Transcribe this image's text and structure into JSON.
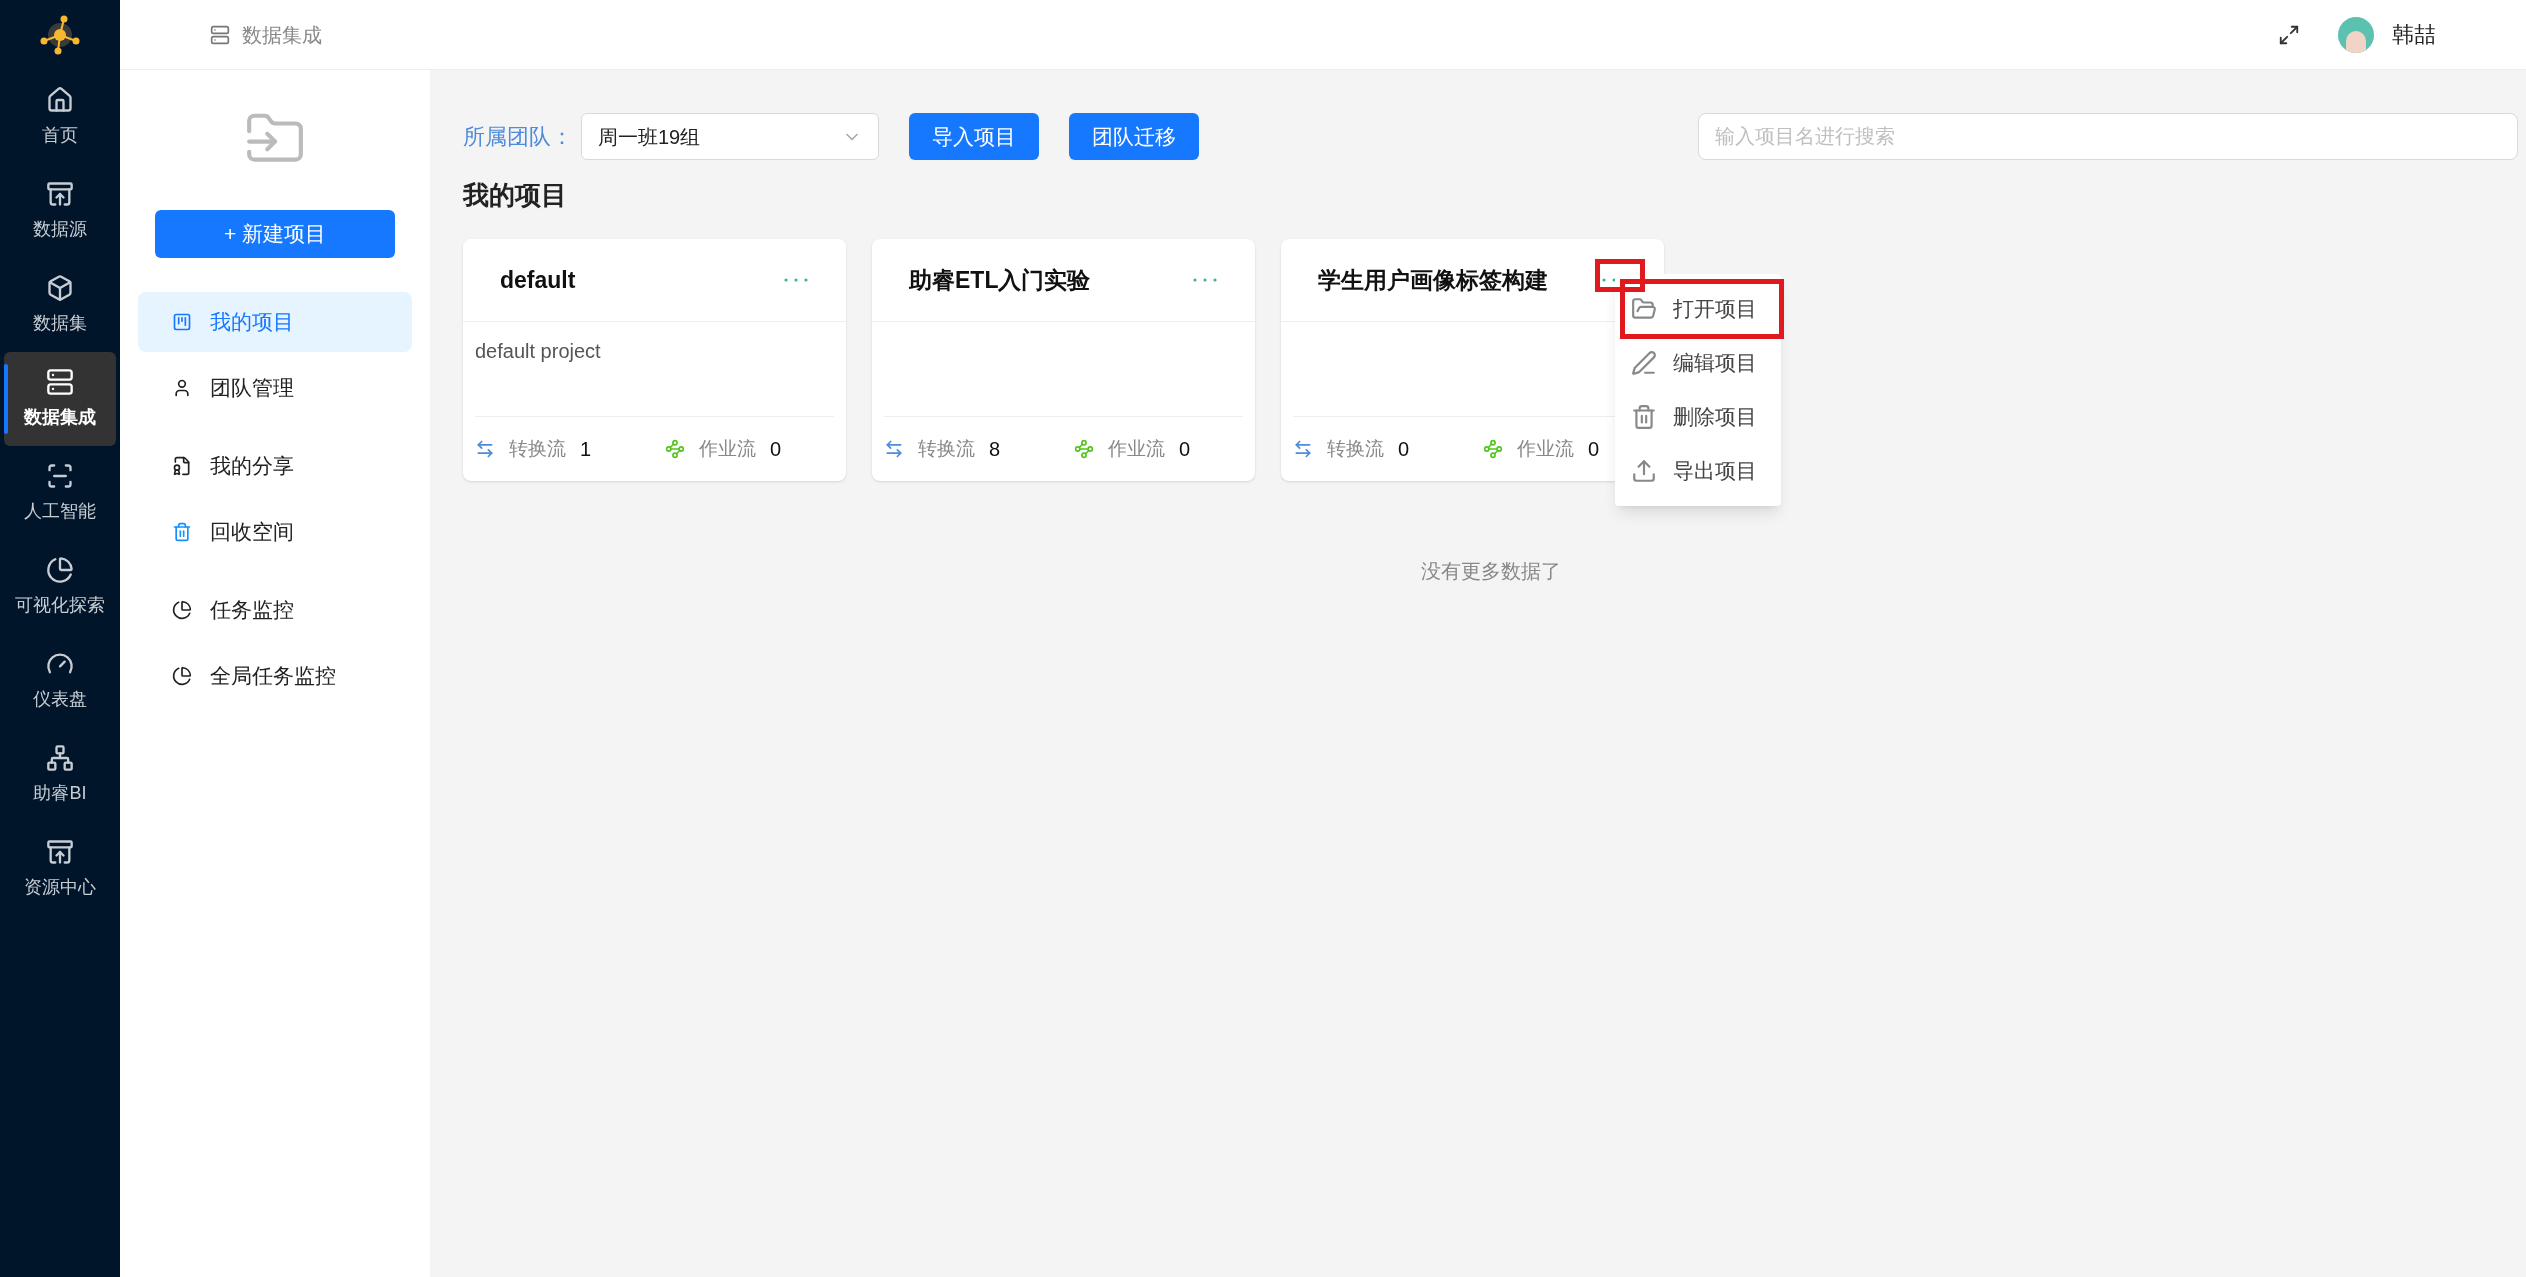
{
  "nav": [
    {
      "label": "首页",
      "kind": "home",
      "selected": false
    },
    {
      "label": "数据源",
      "kind": "cabinet",
      "selected": false
    },
    {
      "label": "数据集",
      "kind": "cube",
      "selected": false
    },
    {
      "label": "数据集成",
      "kind": "server",
      "selected": true
    },
    {
      "label": "人工智能",
      "kind": "scan",
      "selected": false
    },
    {
      "label": "可视化探索",
      "kind": "pie",
      "selected": false
    },
    {
      "label": "仪表盘",
      "kind": "gauge",
      "selected": false
    },
    {
      "label": "助睿BI",
      "kind": "network",
      "selected": false
    },
    {
      "label": "资源中心",
      "kind": "cabinet",
      "selected": false
    }
  ],
  "header": {
    "section_title": "数据集成",
    "user_name": "韩喆"
  },
  "sidebar": {
    "new_button": "+ 新建项目",
    "groups": [
      {
        "items": [
          {
            "label": "我的项目",
            "kind": "board",
            "selected": true
          },
          {
            "label": "团队管理",
            "kind": "user",
            "selected": false
          }
        ]
      },
      {
        "items": [
          {
            "label": "我的分享",
            "kind": "share",
            "selected": false
          },
          {
            "label": "回收空间",
            "kind": "trash",
            "selected": false
          }
        ]
      },
      {
        "items": [
          {
            "label": "任务监控",
            "kind": "pie",
            "selected": false
          },
          {
            "label": "全局任务监控",
            "kind": "pie",
            "selected": false
          }
        ]
      }
    ]
  },
  "toolbar": {
    "team_label": "所属团队：",
    "team_value": "周一班19组",
    "buttons": [
      "导入项目",
      "团队迁移"
    ],
    "search": {
      "placeholder": "输入项目名进行搜索"
    }
  },
  "section_title": "我的项目",
  "projects": [
    {
      "name": "default",
      "description": "default project",
      "transform_label": "转换流",
      "transform_count": "1",
      "job_label": "作业流",
      "job_count": "0",
      "menu_open": false,
      "trigger_highlighted": false
    },
    {
      "name": "助睿ETL入门实验",
      "transform_label": "转换流",
      "transform_count": "8",
      "job_label": "作业流",
      "job_count": "0",
      "menu_open": false,
      "trigger_highlighted": false
    },
    {
      "name": "学生用户画像标签构建",
      "transform_label": "转换流",
      "transform_count": "0",
      "job_label": "作业流",
      "job_count": "0",
      "menu_open": true,
      "trigger_highlighted": true
    }
  ],
  "menu": {
    "items": [
      {
        "label": "打开项目",
        "kind": "folder",
        "highlighted": true
      },
      {
        "label": "编辑项目",
        "kind": "edit",
        "highlighted": false
      },
      {
        "label": "删除项目",
        "kind": "trash",
        "highlighted": false
      },
      {
        "label": "导出项目",
        "kind": "upload",
        "highlighted": false
      }
    ]
  },
  "empty_text": "没有更多数据了"
}
